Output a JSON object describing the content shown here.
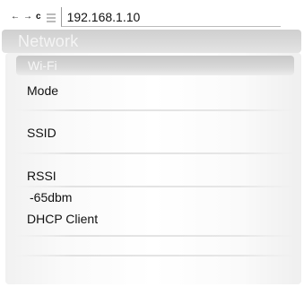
{
  "browser": {
    "back_icon": "back-arrow-icon",
    "forward_icon": "forward-arrow-icon",
    "reload_icon": "reload-icon",
    "url": "192.168.1.10"
  },
  "header": {
    "title": "Network"
  },
  "wifi": {
    "section_title": "Wi-Fi",
    "mode_label": "Mode",
    "mode_value": "",
    "ssid_label": "SSID",
    "ssid_value": "",
    "rssi_label": "RSSI",
    "rssi_value": "-65dbm",
    "dhcp_label": "DHCP Client"
  }
}
